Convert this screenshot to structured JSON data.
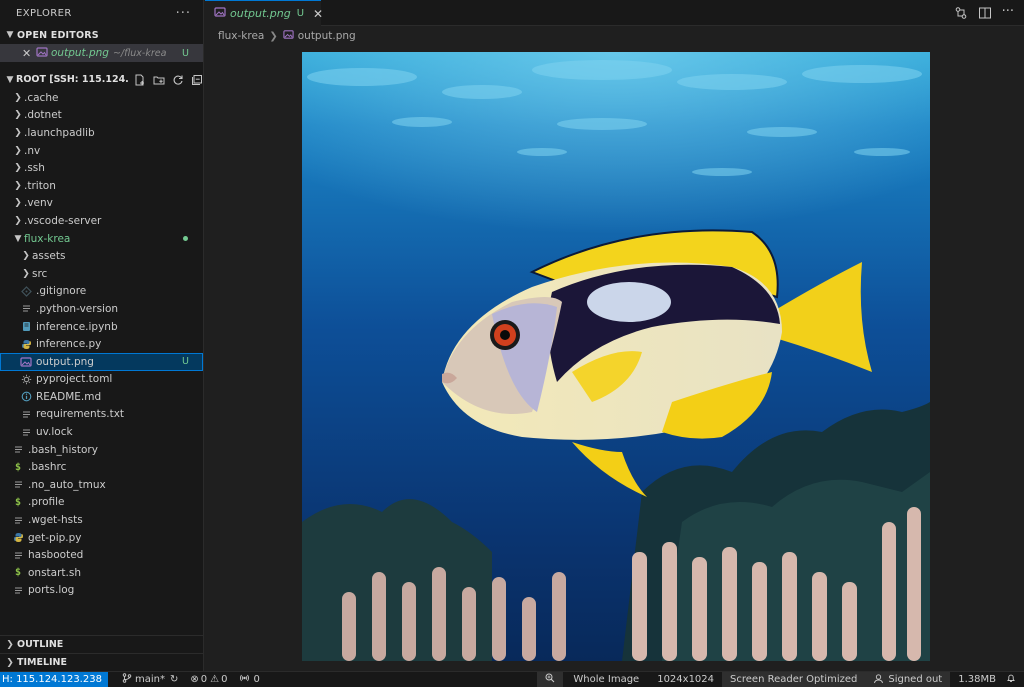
{
  "sidebar": {
    "title": "EXPLORER",
    "more": "···",
    "open_editors": {
      "heading": "OPEN EDITORS",
      "items": [
        {
          "name": "output.png",
          "path": "~/flux-krea",
          "badge": "U"
        }
      ]
    },
    "root": {
      "heading": "ROOT [SSH: 115.124..."
    },
    "tree": [
      {
        "label": ".cache",
        "type": "folder",
        "depth": 0
      },
      {
        "label": ".dotnet",
        "type": "folder",
        "depth": 0
      },
      {
        "label": ".launchpadlib",
        "type": "folder",
        "depth": 0
      },
      {
        "label": ".nv",
        "type": "folder",
        "depth": 0
      },
      {
        "label": ".ssh",
        "type": "folder",
        "depth": 0
      },
      {
        "label": ".triton",
        "type": "folder",
        "depth": 0
      },
      {
        "label": ".venv",
        "type": "folder",
        "depth": 0
      },
      {
        "label": ".vscode-server",
        "type": "folder",
        "depth": 0
      },
      {
        "label": "flux-krea",
        "type": "folder-open",
        "depth": 0,
        "modified": true
      },
      {
        "label": "assets",
        "type": "folder",
        "depth": 1
      },
      {
        "label": "src",
        "type": "folder",
        "depth": 1
      },
      {
        "label": ".gitignore",
        "type": "git",
        "depth": 1
      },
      {
        "label": ".python-version",
        "type": "lines",
        "depth": 1
      },
      {
        "label": "inference.ipynb",
        "type": "notebook",
        "depth": 1
      },
      {
        "label": "inference.py",
        "type": "python",
        "depth": 1
      },
      {
        "label": "output.png",
        "type": "image",
        "depth": 1,
        "badge": "U",
        "selected": true
      },
      {
        "label": "pyproject.toml",
        "type": "gear",
        "depth": 1
      },
      {
        "label": "README.md",
        "type": "info",
        "depth": 1
      },
      {
        "label": "requirements.txt",
        "type": "lines",
        "depth": 1
      },
      {
        "label": "uv.lock",
        "type": "lines",
        "depth": 1
      },
      {
        "label": ".bash_history",
        "type": "lines",
        "depth": 0
      },
      {
        "label": ".bashrc",
        "type": "shell",
        "depth": 0
      },
      {
        "label": ".no_auto_tmux",
        "type": "lines",
        "depth": 0
      },
      {
        "label": ".profile",
        "type": "shell",
        "depth": 0
      },
      {
        "label": ".wget-hsts",
        "type": "lines",
        "depth": 0
      },
      {
        "label": "get-pip.py",
        "type": "python",
        "depth": 0
      },
      {
        "label": "hasbooted",
        "type": "lines",
        "depth": 0
      },
      {
        "label": "onstart.sh",
        "type": "shell",
        "depth": 0
      },
      {
        "label": "ports.log",
        "type": "lines",
        "depth": 0
      }
    ],
    "outline": "OUTLINE",
    "timeline": "TIMELINE"
  },
  "tab": {
    "name": "output.png",
    "badge": "U"
  },
  "breadcrumb": {
    "folder": "flux-krea",
    "file": "output.png"
  },
  "status": {
    "remote": "H: 115.124.123.238",
    "branch": "main*",
    "errors": "0",
    "warnings": "0",
    "ports": "0",
    "zoom_mode": "Whole Image",
    "dimensions": "1024x1024",
    "screen_reader": "Screen Reader Optimized",
    "account": "Signed out",
    "file_size": "1.38MB"
  },
  "colors": {
    "accent": "#0078d4",
    "untracked": "#73c991",
    "selected_bg": "#04395e"
  }
}
